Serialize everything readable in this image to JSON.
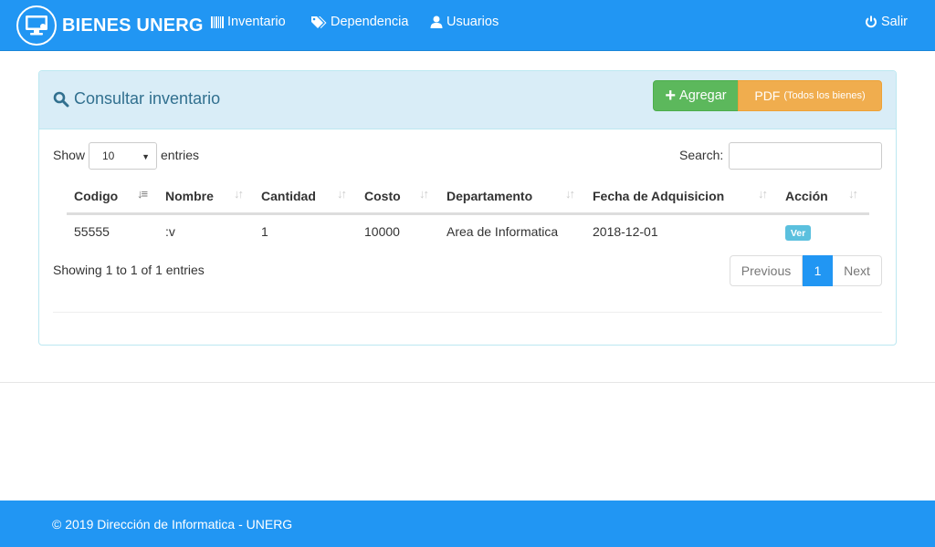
{
  "navbar": {
    "brand": "BIENES UNERG",
    "items": [
      {
        "label": "Inventario",
        "icon": "barcode-icon"
      },
      {
        "label": "Dependencia",
        "icon": "tags-icon"
      },
      {
        "label": "Usuarios",
        "icon": "user-icon"
      }
    ],
    "logout": {
      "label": "Salir",
      "icon": "power-icon"
    },
    "color": "#2196f3"
  },
  "panel": {
    "title": "Consultar inventario",
    "title_icon": "search-icon",
    "add_button": "Agregar",
    "pdf_button": "PDF",
    "pdf_button_note": "(Todos los bienes)"
  },
  "table_controls": {
    "show_label": "Show",
    "entries_value": "10",
    "entries_label": "entries",
    "search_label": "Search:",
    "search_value": ""
  },
  "table": {
    "columns": [
      "Codigo",
      "Nombre",
      "Cantidad",
      "Costo",
      "Departamento",
      "Fecha de Adquisicion",
      "Acción"
    ],
    "sorted_column": "Codigo",
    "rows": [
      {
        "codigo": "55555",
        "nombre": ":v",
        "cantidad": "1",
        "costo": "10000",
        "departamento": "Area de Informatica",
        "fecha": "2018-12-01",
        "accion": "Ver"
      }
    ]
  },
  "info": "Showing 1 to 1 of 1 entries",
  "pagination": {
    "previous": "Previous",
    "current": "1",
    "next": "Next"
  },
  "footer": {
    "text": "© 2019 Dirección de Informatica - UNERG"
  }
}
